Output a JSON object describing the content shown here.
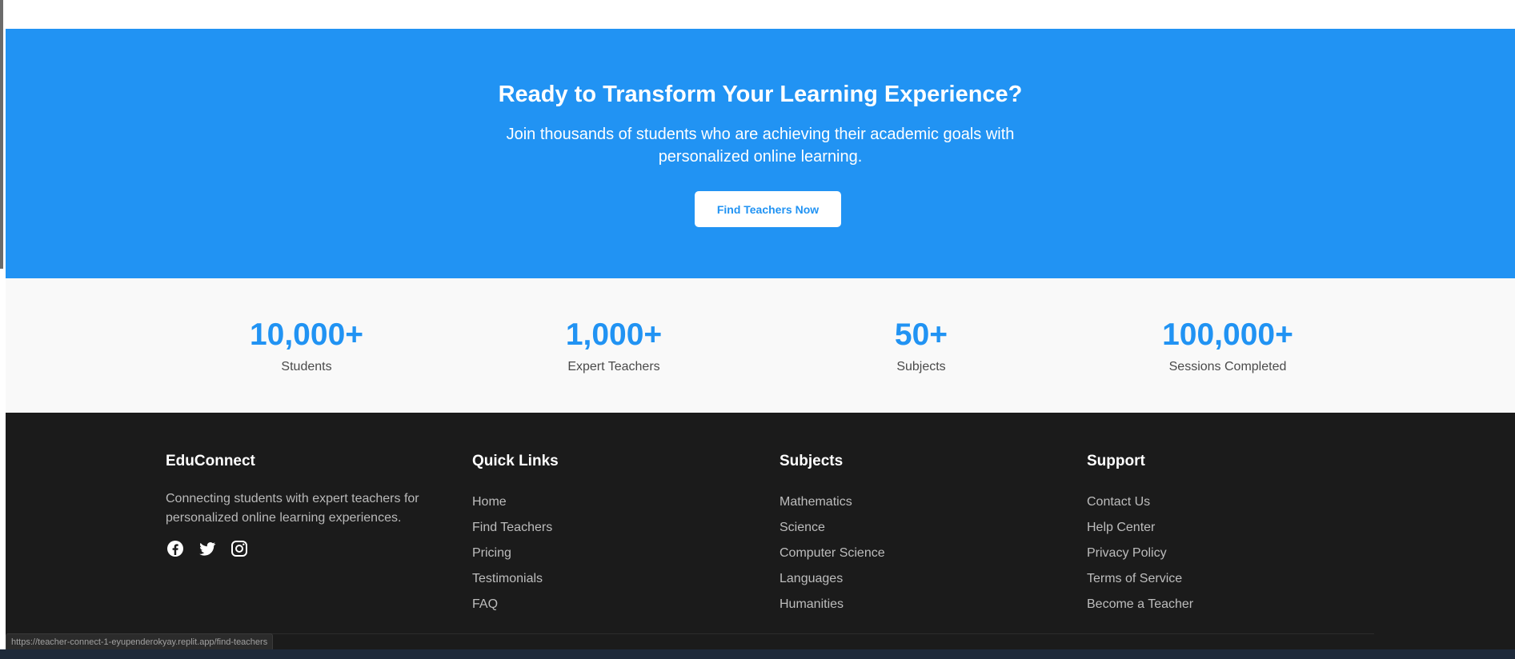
{
  "cta": {
    "title": "Ready to Transform Your Learning Experience?",
    "text": "Join thousands of students who are achieving their academic goals with personalized online learning.",
    "button_label": "Find Teachers Now"
  },
  "stats": [
    {
      "value": "10,000+",
      "label": "Students"
    },
    {
      "value": "1,000+",
      "label": "Expert Teachers"
    },
    {
      "value": "50+",
      "label": "Subjects"
    },
    {
      "value": "100,000+",
      "label": "Sessions Completed"
    }
  ],
  "footer": {
    "brand": "EduConnect",
    "description": "Connecting students with expert teachers for personalized online learning experiences.",
    "social_icons": [
      "facebook-icon",
      "twitter-icon",
      "instagram-icon"
    ],
    "quick_links": {
      "heading": "Quick Links",
      "items": [
        "Home",
        "Find Teachers",
        "Pricing",
        "Testimonials",
        "FAQ"
      ]
    },
    "subjects": {
      "heading": "Subjects",
      "items": [
        "Mathematics",
        "Science",
        "Computer Science",
        "Languages",
        "Humanities"
      ]
    },
    "support": {
      "heading": "Support",
      "items": [
        "Contact Us",
        "Help Center",
        "Privacy Policy",
        "Terms of Service",
        "Become a Teacher"
      ]
    }
  },
  "status_bar": {
    "url": "https://teacher-connect-1-eyupenderokyay.replit.app/find-teachers"
  },
  "colors": {
    "accent": "#2193f3",
    "footer_bg": "#1b1b1b",
    "stats_bg": "#f9f9f9"
  }
}
